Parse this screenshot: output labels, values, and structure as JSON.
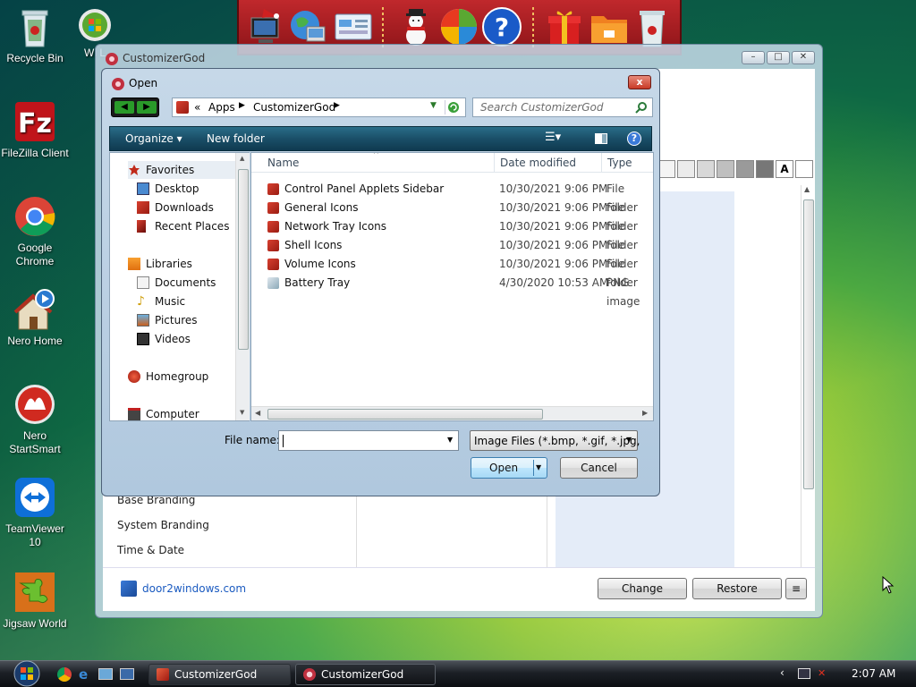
{
  "desktop": {
    "icons": [
      {
        "label": "Recycle Bin"
      },
      {
        "label": "FileZilla Client"
      },
      {
        "label": "Google Chrome"
      },
      {
        "label": "Nero Home"
      },
      {
        "label": "Nero StartSmart"
      },
      {
        "label": "TeamViewer 10"
      },
      {
        "label": "Jigsaw World"
      }
    ],
    "partial_icon_label": "Wi L"
  },
  "customizergod_window": {
    "title": "CustomizerGod",
    "left_items": [
      "Base Branding",
      "System Branding",
      "Time & Date"
    ],
    "link": "door2windows.com",
    "change_button": "Change",
    "restore_button": "Restore",
    "menu_button": "≡",
    "swatch_text": "A",
    "swatch_colors": [
      "#f4f4f4",
      "#ebebeb",
      "#d8d8d8",
      "#bfbfbf",
      "#9a9a9a",
      "#777777",
      "#4a4a4a",
      "#ffffff",
      "#000000"
    ]
  },
  "open_dialog": {
    "title": "Open",
    "close_label": "x",
    "address": {
      "prefix": "«",
      "crumbs": [
        "Apps",
        "CustomizerGod"
      ]
    },
    "search_placeholder": "Search CustomizerGod",
    "toolbar": {
      "organize": "Organize ▾",
      "new_folder": "New folder"
    },
    "nav": {
      "favorites": "Favorites",
      "favorites_items": [
        "Desktop",
        "Downloads",
        "Recent Places"
      ],
      "libraries": "Libraries",
      "libraries_items": [
        "Documents",
        "Music",
        "Pictures",
        "Videos"
      ],
      "homegroup": "Homegroup",
      "computer": "Computer"
    },
    "columns": {
      "name": "Name",
      "date": "Date modified",
      "type": "Type"
    },
    "files": [
      {
        "name": "Control Panel Applets Sidebar",
        "date": "10/30/2021 9:06 PM",
        "type": "File folder"
      },
      {
        "name": "General Icons",
        "date": "10/30/2021 9:06 PM",
        "type": "File folder"
      },
      {
        "name": "Network Tray Icons",
        "date": "10/30/2021 9:06 PM",
        "type": "File folder"
      },
      {
        "name": "Shell Icons",
        "date": "10/30/2021 9:06 PM",
        "type": "File folder"
      },
      {
        "name": "Volume Icons",
        "date": "10/30/2021 9:06 PM",
        "type": "File folder"
      },
      {
        "name": "Battery Tray",
        "date": "4/30/2020 10:53 AM",
        "type": "PNG image"
      }
    ],
    "filename_label": "File name:",
    "filename_value": "",
    "filter_value": "Image Files (*.bmp, *.gif, *.jpg,",
    "open_button": "Open",
    "cancel_button": "Cancel"
  },
  "taskbar": {
    "tasks": [
      "CustomizerGod",
      "CustomizerGod"
    ],
    "clock": "2:07 AM"
  },
  "colors": {
    "accent_red": "#c0282c",
    "cmdbar": "#1a4f68",
    "taskbar": "#1c2026"
  }
}
